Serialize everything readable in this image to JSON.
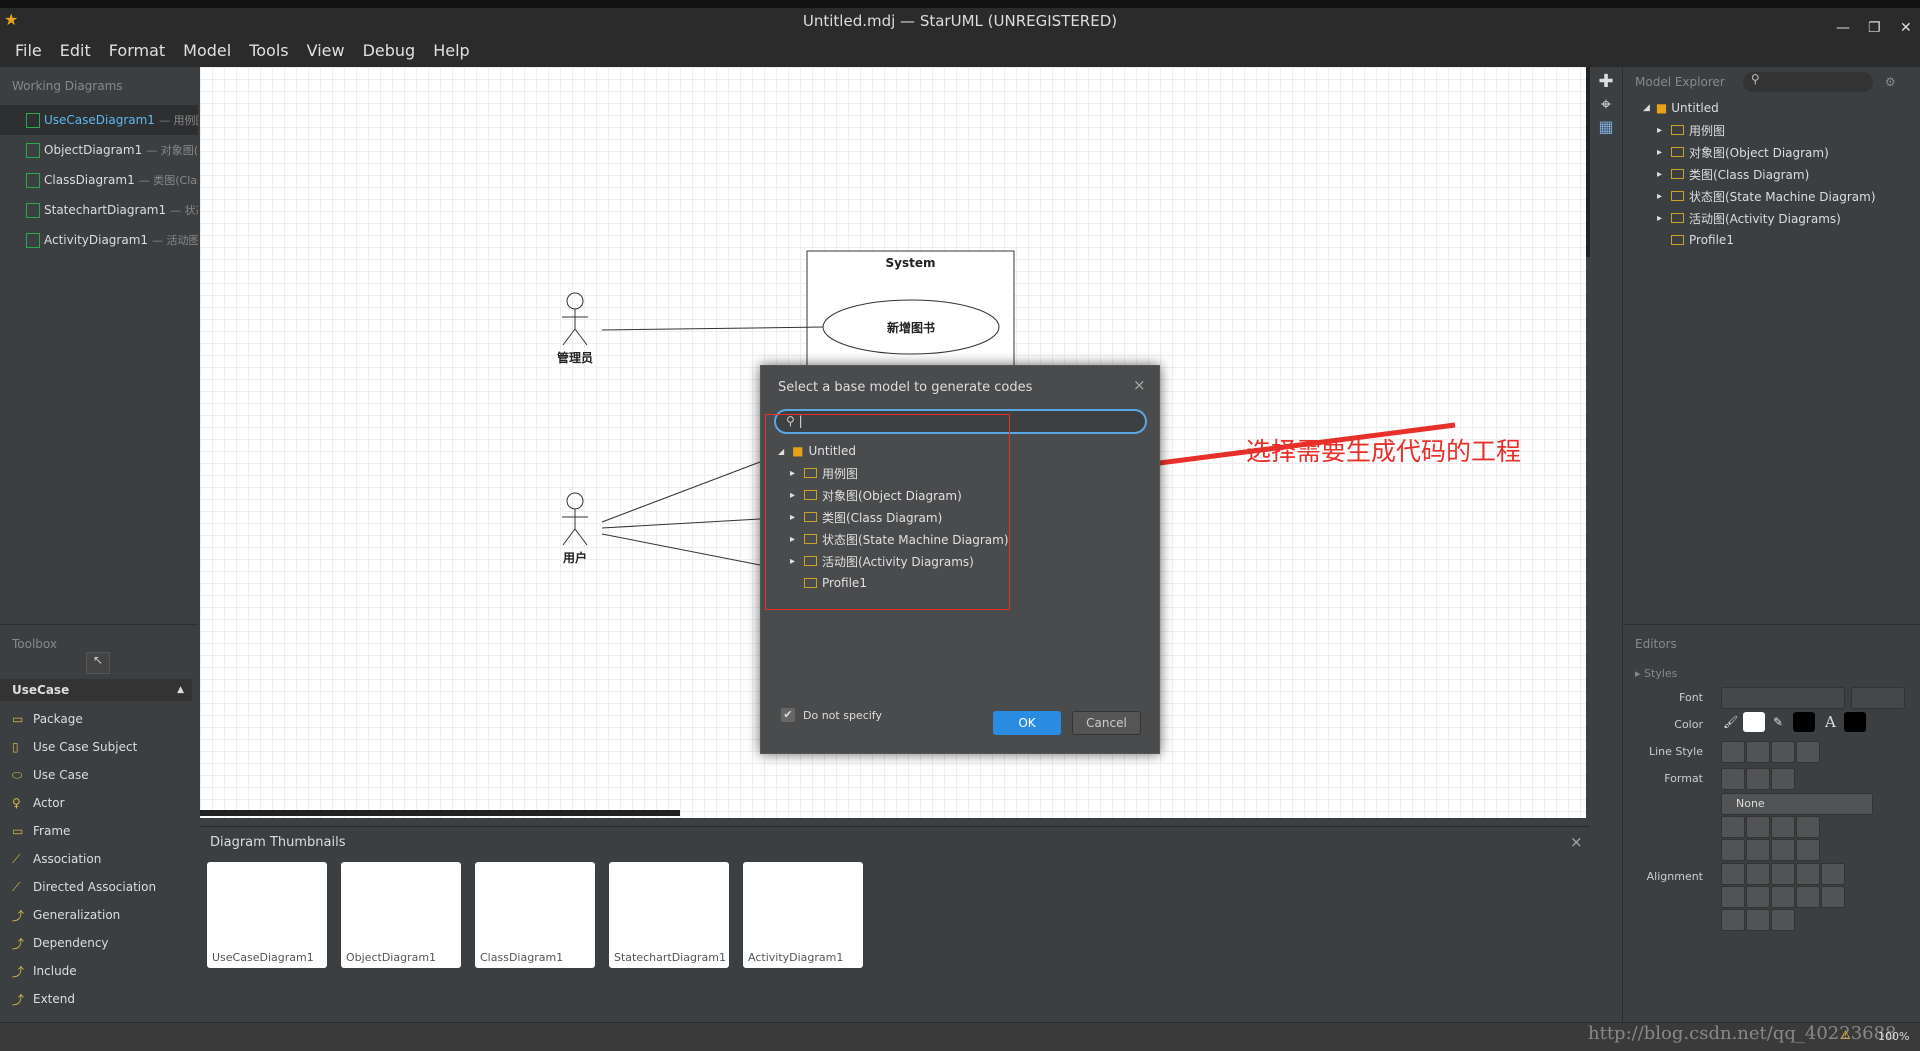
{
  "window": {
    "title": "Untitled.mdj — StarUML (UNREGISTERED)",
    "minimize": "—",
    "restore": "❐",
    "close": "✕"
  },
  "menu": [
    "File",
    "Edit",
    "Format",
    "Model",
    "Tools",
    "View",
    "Debug",
    "Help"
  ],
  "working_diagrams": {
    "header": "Working Diagrams",
    "items": [
      {
        "name": "UseCaseDiagram1",
        "sub": "— 用例图"
      },
      {
        "name": "ObjectDiagram1",
        "sub": "— 对象图(Ob"
      },
      {
        "name": "ClassDiagram1",
        "sub": "— 类图(Class D"
      },
      {
        "name": "StatechartDiagram1",
        "sub": "— 状态图"
      },
      {
        "name": "ActivityDiagram1",
        "sub": "— 活动图(Ac"
      }
    ]
  },
  "toolbox": {
    "header": "Toolbox",
    "group": "UseCase",
    "items": [
      "Package",
      "Use Case Subject",
      "Use Case",
      "Actor",
      "Frame",
      "Association",
      "Directed Association",
      "Generalization",
      "Dependency",
      "Include",
      "Extend"
    ]
  },
  "canvas": {
    "system_label": "System",
    "usecase": "新增图书",
    "actor1": "管理员",
    "actor2": "用户"
  },
  "annotation": "选择需要生成代码的工程",
  "annotation_color": "#e8302a",
  "dialog": {
    "title": "Select a base model to generate codes",
    "search_value": "",
    "tree": {
      "root": "Untitled",
      "children": [
        "用例图",
        "对象图(Object Diagram)",
        "类图(Class Diagram)",
        "状态图(State Machine Diagram)",
        "活动图(Activity Diagrams)",
        "Profile1"
      ]
    },
    "checkbox_label": "Do not specify",
    "checkbox_checked": true,
    "ok": "OK",
    "cancel": "Cancel",
    "close": "×"
  },
  "model_explorer": {
    "header": "Model Explorer",
    "root": "Untitled",
    "children": [
      "用例图",
      "对象图(Object Diagram)",
      "类图(Class Diagram)",
      "状态图(State Machine Diagram)",
      "活动图(Activity Diagrams)",
      "Profile1"
    ]
  },
  "editors": {
    "header": "Editors",
    "styles": "Styles",
    "font": "Font",
    "color": "Color",
    "line_style": "Line Style",
    "format": "Format",
    "format_value": "None",
    "alignment": "Alignment"
  },
  "thumbnails": {
    "header": "Diagram Thumbnails",
    "close": "×",
    "items": [
      "UseCaseDiagram1",
      "ObjectDiagram1",
      "ClassDiagram1",
      "StatechartDiagram1",
      "ActivityDiagram1"
    ]
  },
  "status": {
    "watermark": "http://blog.csdn.net/qq_40223688",
    "zoom": "100%"
  }
}
